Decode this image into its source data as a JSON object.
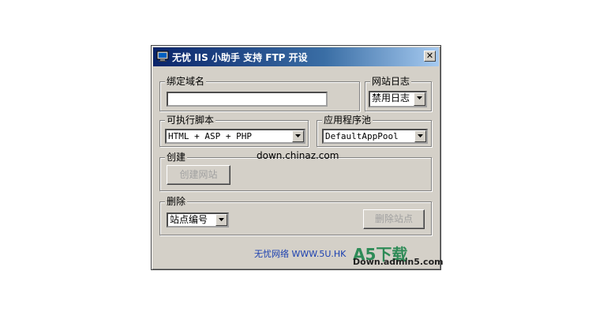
{
  "window": {
    "title": "无忧 IIS 小助手 支持 FTP 开设",
    "close_label": "✕"
  },
  "domain_group": {
    "legend": "绑定域名",
    "input_value": ""
  },
  "log_group": {
    "legend": "网站日志",
    "selected": "禁用日志"
  },
  "script_group": {
    "legend": "可执行脚本",
    "selected": "HTML + ASP + PHP"
  },
  "pool_group": {
    "legend": "应用程序池",
    "selected": "DefaultAppPool"
  },
  "create_group": {
    "legend": "创建",
    "button_label": "创建网站"
  },
  "delete_group": {
    "legend": "删除",
    "selected": "站点编号",
    "button_label": "删除站点"
  },
  "footer": {
    "link_text": "无忧网络 WWW.5U.HK"
  },
  "watermark": "down.chinaz.com",
  "logo": {
    "main": "A5下载",
    "sub": "Down.admin5.com"
  },
  "icons": {
    "app": "monitor-icon",
    "dropdown": "triangle-down-icon"
  }
}
